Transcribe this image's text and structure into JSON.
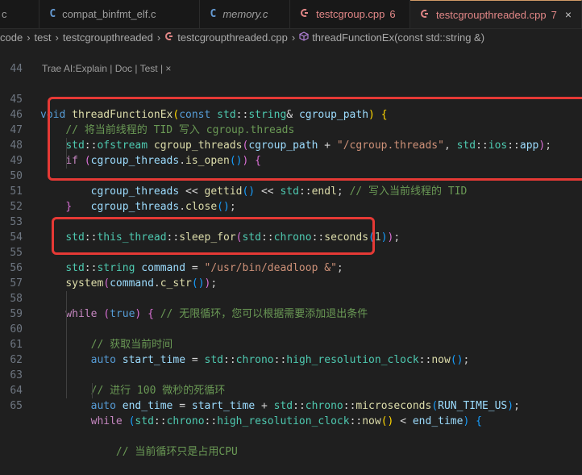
{
  "tabs": [
    {
      "icon": "",
      "label": "c",
      "active": false
    },
    {
      "icon": "C",
      "label": "compat_binfmt_elf.c",
      "active": false
    },
    {
      "icon": "C",
      "label": "memory.c",
      "active": false
    },
    {
      "icon": "G",
      "label": "testcgroup.cpp",
      "count": "6",
      "active": false
    },
    {
      "icon": "G",
      "label": "testcgroupthreaded.cpp",
      "count": "7",
      "active": true,
      "close": "×"
    }
  ],
  "breadcrumb": [
    "code",
    "test",
    "testcgroupthreaded",
    "testcgroupthreaded.cpp",
    "threadFunctionEx(const std::string &)"
  ],
  "codelens": "Trae AI:Explain | Doc | Test | ×",
  "line_numbers": [
    "44",
    "45",
    "46",
    "47",
    "48",
    "49",
    "50",
    "51",
    "52",
    "53",
    "54",
    "55",
    "56",
    "57",
    "58",
    "59",
    "60",
    "61",
    "62",
    "63",
    "64",
    "65"
  ],
  "code": {
    "l45_void": "void",
    "l45_fn": "threadFunctionEx",
    "l45_const": "const",
    "l45_std": "std",
    "l45_string": "string",
    "l45_param": "cgroup_path",
    "l46_comment": "// 将当前线程的 TID 写入 cgroup.threads",
    "l47_ofstream": "ofstream",
    "l47_var": "cgroup_threads",
    "l47_path": "cgroup_path",
    "l47_str": "\"/cgroup.threads\"",
    "l47_ios": "ios",
    "l47_app": "app",
    "l48_if": "if",
    "l48_var": "cgroup_threads",
    "l48_method": "is_open",
    "l49_var": "cgroup_threads",
    "l49_fn": "gettid",
    "l49_endl": "endl",
    "l49_comment": "// 写入当前线程的 TID",
    "l50_var": "cgroup_threads",
    "l50_method": "close",
    "l53_this_thread": "this_thread",
    "l53_sleep": "sleep_for",
    "l53_chrono": "chrono",
    "l53_seconds": "seconds",
    "l53_num": "1",
    "l55_string": "string",
    "l55_var": "command",
    "l55_str": "\"/usr/bin/deadloop &\"",
    "l56_system": "system",
    "l56_var": "command",
    "l56_method": "c_str",
    "l58_while": "while",
    "l58_true": "true",
    "l58_comment": "// 无限循环，您可以根据需要添加退出条件",
    "l59_comment": "// 获取当前时间",
    "l60_auto": "auto",
    "l60_var": "start_time",
    "l60_chrono": "chrono",
    "l60_clock": "high_resolution_clock",
    "l60_now": "now",
    "l62_comment": "// 进行 100 微秒的死循环",
    "l63_auto": "auto",
    "l63_var": "end_time",
    "l63_start": "start_time",
    "l63_chrono": "chrono",
    "l63_micro": "microseconds",
    "l63_macro": "RUN_TIME_US",
    "l64_while": "while",
    "l64_chrono": "chrono",
    "l64_clock": "high_resolution_clock",
    "l64_now": "now",
    "l64_end": "end_time",
    "l65_comment": "// 当前循环只是占用CPU"
  }
}
